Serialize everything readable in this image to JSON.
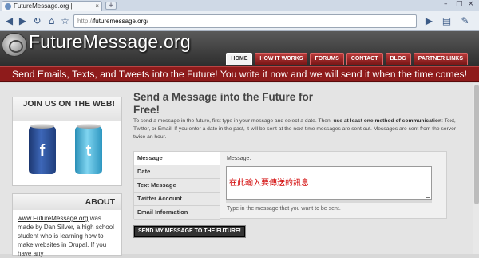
{
  "browser": {
    "tab_title": "FutureMessage.org |",
    "new_tab": "+",
    "url_proto": "http://",
    "url_domain": "futuremessage.org",
    "url_path": "/"
  },
  "site": {
    "title": "FutureMessage.org",
    "nav": [
      {
        "label": "HOME",
        "active": true
      },
      {
        "label": "HOW IT WORKS"
      },
      {
        "label": "FORUMS"
      },
      {
        "label": "CONTACT"
      },
      {
        "label": "BLOG"
      },
      {
        "label": "PARTNER LINKS"
      }
    ],
    "banner": "Send Emails, Texts, and Tweets into the Future! You write it now and we will send it when the time comes!"
  },
  "sidebar": {
    "join_title": "JOIN US ON THE WEB!",
    "facebook_glyph": "f",
    "twitter_glyph": "t",
    "about_title": "ABOUT",
    "about_link": "www.FutureMessage.org",
    "about_text": " was made by Dan Silver, a high school student who is learning how to make websites in Drupal. If you have any"
  },
  "main": {
    "title": "Send a Message into the Future for Free!",
    "intro_1": "To send a message in the future, first type in your message and select a date. Then, ",
    "intro_bold": "use at least one method of communication",
    "intro_2": ": Text, Twitter, or Email. If you enter a date in the past, it will be sent at the next time messages are sent out. Messages are sent from the server twice an hour.",
    "tabs": [
      "Message",
      "Date",
      "Text Message",
      "Twitter Account",
      "Email Information"
    ],
    "message_label": "Message:",
    "message_value": "在此輸入要傳送的訊息",
    "message_desc": "Type in the message that you want to be sent.",
    "submit": "SEND MY MESSAGE TO THE FUTURE!"
  }
}
